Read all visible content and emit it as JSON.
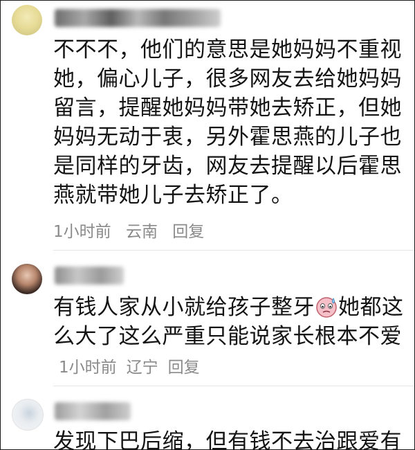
{
  "comments": [
    {
      "text": "不不不，他们的意思是她妈妈不重视她，偏心儿子，很多网友去给她妈妈留言，提醒她妈妈带她去矫正，但她妈妈无动于衷，另外霍思燕的儿子也是同样的牙齿，网友去提醒以后霍思燕就带她儿子去矫正了。",
      "time": "1小时前",
      "location": "云南",
      "reply": "回复"
    },
    {
      "text_part1": "有钱人家从小就给孩子整牙",
      "emoji": "sweat-face-emoji",
      "text_part2": "她都这么大了这么严重只能说家长根本不爱",
      "time": "1小时前",
      "location": "辽宁",
      "reply": "回复"
    },
    {
      "text": "发现下巴后缩，但有钱不去治跟爱有"
    }
  ]
}
